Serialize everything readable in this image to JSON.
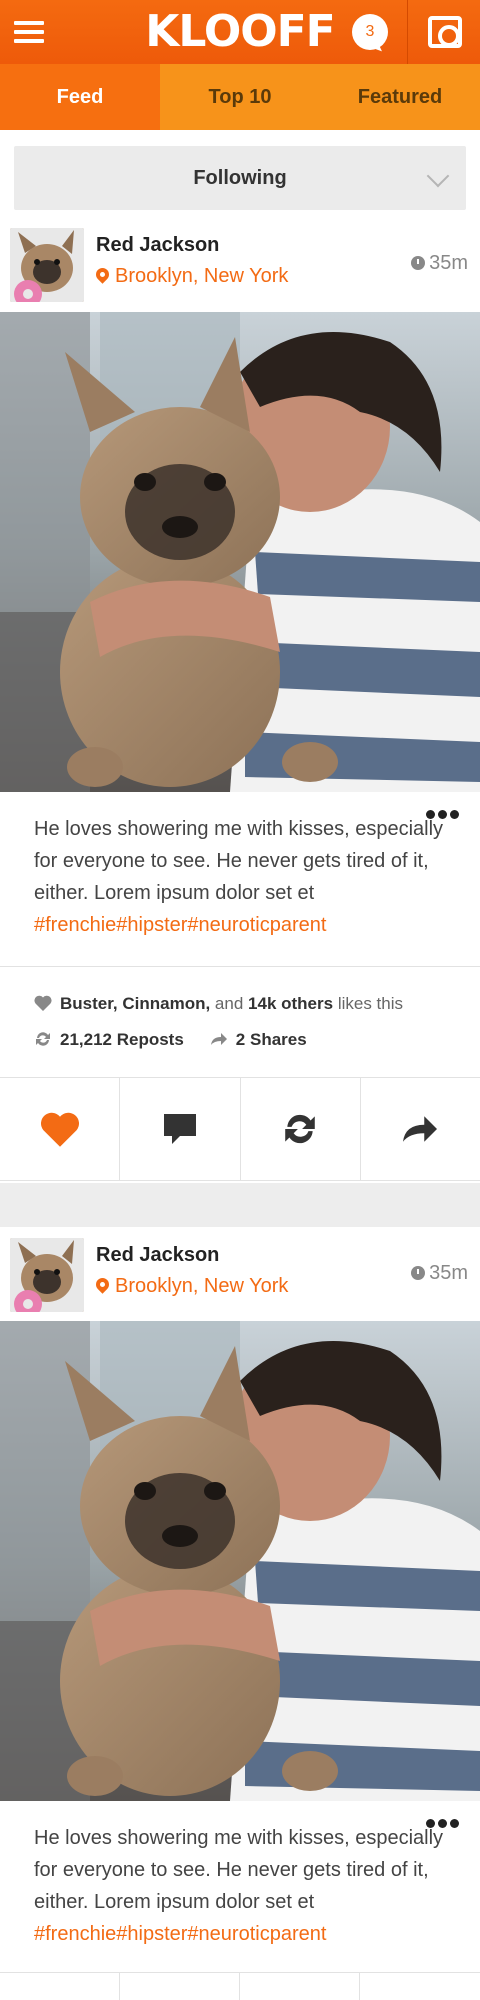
{
  "header": {
    "menu_icon": "hamburger-menu-icon",
    "logo": "KLOOFF",
    "notification_count": "3",
    "notification_icon": "chat-bubble-icon",
    "camera_icon": "camera-icon",
    "colors": {
      "primary": "#f26a12",
      "tab_bar": "#f7931a",
      "active_tab": "#f66f10"
    }
  },
  "tabs": [
    {
      "label": "Feed",
      "active": true
    },
    {
      "label": "Top 10",
      "active": false
    },
    {
      "label": "Featured",
      "active": false
    }
  ],
  "filter": {
    "selected": "Following"
  },
  "posts": [
    {
      "user": "Red Jackson",
      "location": "Brooklyn, New York",
      "time": "35m",
      "caption_text": "He loves showering me with kisses, especially for everyone to see. He never gets tired of it, either. Lorem ipsum dolor set et ",
      "caption_tags": "#frenchie#hipster#neuroticparent",
      "likes_names": "Buster, Cinnamon,",
      "likes_and": "and",
      "likes_count": "14k others",
      "likes_suffix": "likes this",
      "reposts": "21,212 Reposts",
      "shares": "2 Shares"
    },
    {
      "user": "Red Jackson",
      "location": "Brooklyn, New York",
      "time": "35m",
      "caption_text": "He loves showering me with kisses, especially for everyone to see. He never gets tired of it, either. Lorem ipsum dolor set et ",
      "caption_tags": "#frenchie#hipster#neuroticparent"
    }
  ],
  "actions": [
    "heart-icon",
    "comment-icon",
    "repost-icon",
    "share-icon"
  ]
}
